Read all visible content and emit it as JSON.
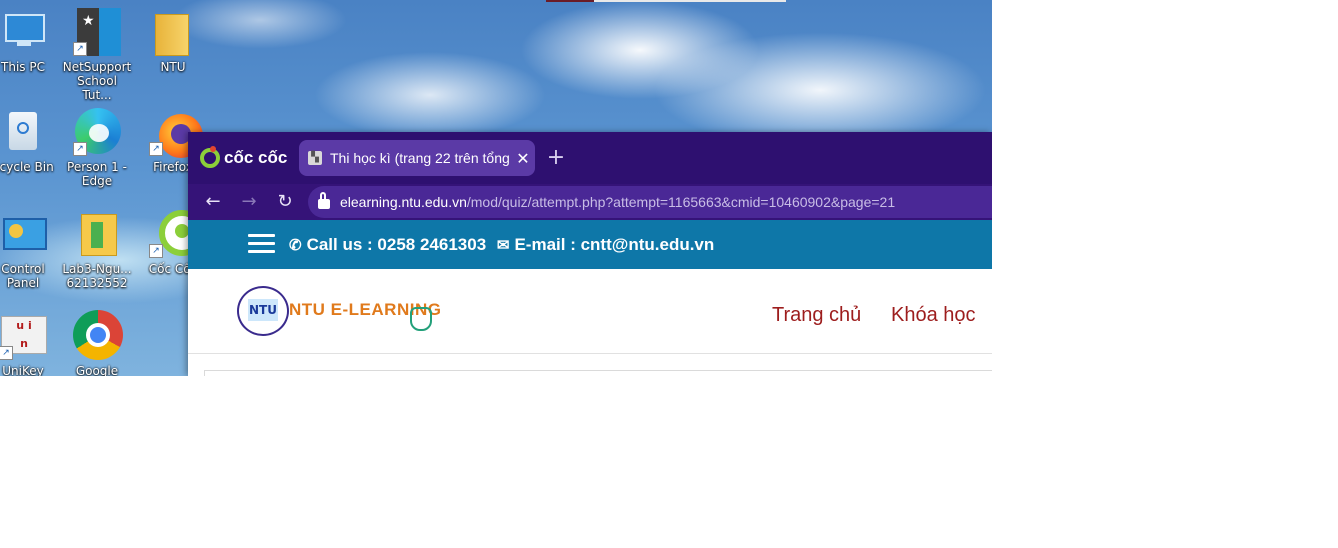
{
  "desktop": {
    "icons": [
      {
        "label_line1": "This PC",
        "label_line2": ""
      },
      {
        "label_line1": "NetSupport",
        "label_line2": "School Tut..."
      },
      {
        "label_line1": "NTU",
        "label_line2": ""
      },
      {
        "label_line1": "ecycle Bin",
        "label_line2": ""
      },
      {
        "label_line1": "Person 1 -",
        "label_line2": "Edge"
      },
      {
        "label_line1": "Firefox",
        "label_line2": ""
      },
      {
        "label_line1": "Control",
        "label_line2": "Panel"
      },
      {
        "label_line1": "Lab3-Ngu...",
        "label_line2": "62132552"
      },
      {
        "label_line1": "Cốc Cốc",
        "label_line2": ""
      },
      {
        "label_line1": "UniKey",
        "label_line2": ""
      },
      {
        "label_line1": "Google",
        "label_line2": ""
      }
    ]
  },
  "browser": {
    "brand": "cốc cốc",
    "tab_title": "Thi học kì (trang 22 trên tổng",
    "tab_close": "✕",
    "new_tab": "+",
    "nav": {
      "back": "←",
      "forward": "→",
      "reload": "↻"
    },
    "url_host": "elearning.ntu.edu.vn",
    "url_path": "/mod/quiz/attempt.php?attempt=1165663&cmid=10460902&page=21"
  },
  "site": {
    "phone_label": "Call us : 0258 2461303",
    "email_label": "E-mail : cntt@ntu.edu.vn",
    "logo_text": "NTU",
    "title": "NTU E-LEARNING",
    "nav": [
      "Trang chủ",
      "Khóa học"
    ]
  },
  "colors": {
    "tabbar": "#2e1070",
    "site_bar": "#0e77a8",
    "nav_link": "#9d1d1d",
    "title": "#e07a1c"
  }
}
